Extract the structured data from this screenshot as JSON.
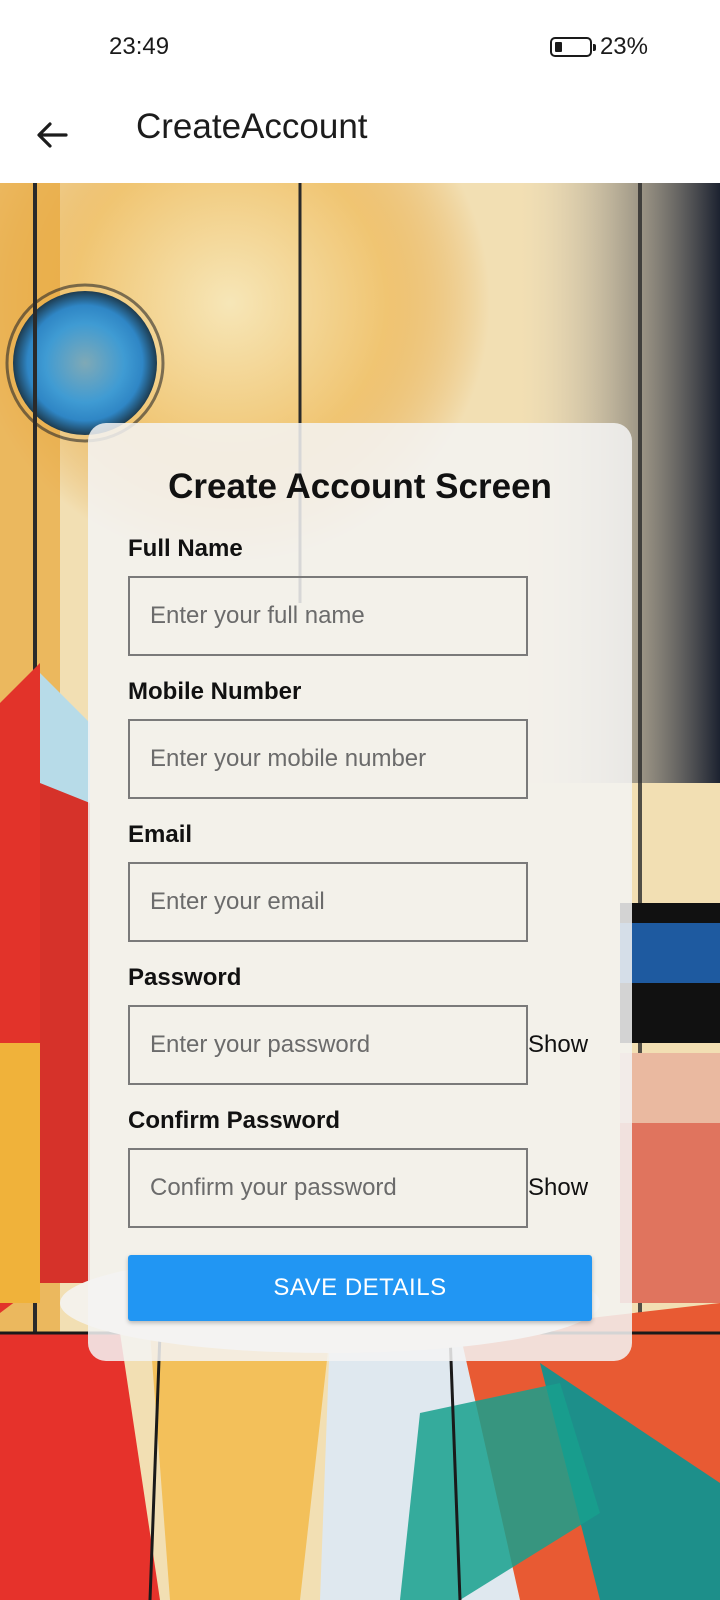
{
  "status_bar": {
    "time": "23:49",
    "battery_percent": "23%",
    "battery_level": 0.23
  },
  "app_bar": {
    "title": "CreateAccount",
    "back_icon": "arrow-left-icon"
  },
  "form": {
    "heading": "Create Account Screen",
    "fields": [
      {
        "label": "Full Name",
        "placeholder": "Enter your full name"
      },
      {
        "label": "Mobile Number",
        "placeholder": "Enter your mobile number"
      },
      {
        "label": "Email",
        "placeholder": "Enter your email"
      },
      {
        "label": "Password",
        "placeholder": "Enter your password",
        "toggle": "Show"
      },
      {
        "label": "Confirm Password",
        "placeholder": "Confirm your password",
        "toggle": "Show"
      }
    ],
    "submit_label": "SAVE DETAILS"
  },
  "colors": {
    "accent": "#2196f3",
    "card_bg": "#f3f3f3",
    "input_border": "#7a7a7a"
  }
}
